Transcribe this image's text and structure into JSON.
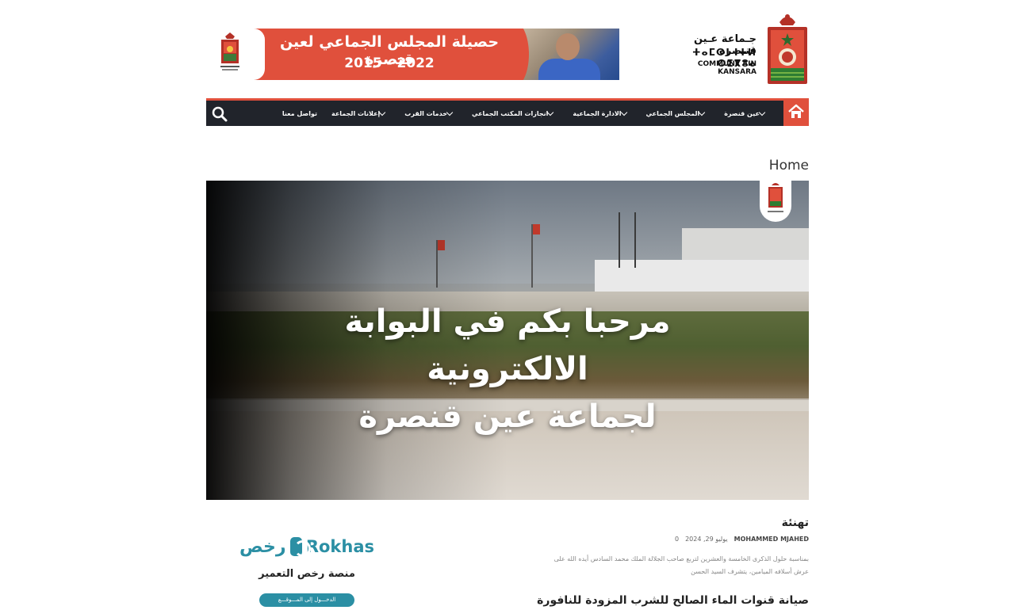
{
  "header": {
    "banner_title": "حصيلة المجلس الجماعي لعين قنصرة",
    "banner_years": "2015 - 2022",
    "commune_ar": "جـماعة عـين قنـصرة",
    "commune_tifinagh": "ⵜⴰⵎⵙⵏ ⵏⵜⵍ ⵔⵉⴳⵓⴰ",
    "commune_fr": "COMMUNE AIN KANSARA"
  },
  "nav": {
    "items": [
      {
        "label": "عين قنصرة",
        "has_dropdown": true
      },
      {
        "label": "المجلس الجماعي",
        "has_dropdown": true
      },
      {
        "label": "الادارة الجماعية",
        "has_dropdown": true
      },
      {
        "label": "انجازات المكتب الجماعي",
        "has_dropdown": true
      },
      {
        "label": "خدمات القرب",
        "has_dropdown": true
      },
      {
        "label": "إعلانات الجماعة",
        "has_dropdown": true
      },
      {
        "label": "تواصل معنا",
        "has_dropdown": false
      }
    ],
    "home_icon": "home-icon",
    "search_icon": "search-icon"
  },
  "breadcrumb": "Home",
  "hero": {
    "line1": "مرحبا بكم في البوابة الالكترونية",
    "line2": "لجماعة عين قنصرة"
  },
  "posts": [
    {
      "title": "تهنئة",
      "author": "MOHAMMED MJAHED",
      "date": "يوليو 29, 2024",
      "comments": "0",
      "excerpt": "بمناسبة حلول الذكرى الخامسة والعشرين لتربع صاحب الجلالة الملك محمد السادس أيده الله على عرش أسلافه الميامين، يتشرف السيد الحسن"
    },
    {
      "title": "صيانة قنوات الماء الصالح للشرب المزودة للنافورة"
    }
  ],
  "sidebar": {
    "rokhas_ar": "رخص",
    "rokhas_en": "Rokhas",
    "rokhas_subtitle": "منصة رخص التعمير",
    "rokhas_button": "الدخـــول إلى المـــوقـــع"
  },
  "colors": {
    "accent": "#e0503c",
    "nav_bg": "#21242b",
    "rokhas": "#2b8fa4"
  }
}
